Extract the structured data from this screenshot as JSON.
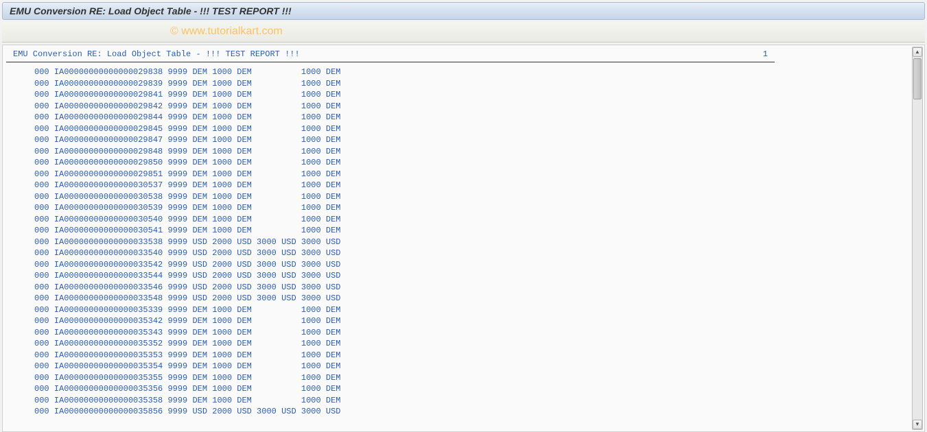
{
  "header": {
    "title": "EMU Conversion RE: Load Object Table - !!! TEST REPORT !!!"
  },
  "watermark": "© www.tutorialkart.com",
  "report": {
    "heading": "EMU Conversion RE: Load Object Table - !!! TEST REPORT !!!",
    "page": "1",
    "rows": [
      {
        "c1": "000",
        "id": "IA00000000000000029838",
        "c2": "9999",
        "c3": "DEM",
        "c4": "1000",
        "c5": "DEM",
        "c6": "",
        "c7": "",
        "c8": "1000",
        "c9": "DEM"
      },
      {
        "c1": "000",
        "id": "IA00000000000000029839",
        "c2": "9999",
        "c3": "DEM",
        "c4": "1000",
        "c5": "DEM",
        "c6": "",
        "c7": "",
        "c8": "1000",
        "c9": "DEM"
      },
      {
        "c1": "000",
        "id": "IA00000000000000029841",
        "c2": "9999",
        "c3": "DEM",
        "c4": "1000",
        "c5": "DEM",
        "c6": "",
        "c7": "",
        "c8": "1000",
        "c9": "DEM"
      },
      {
        "c1": "000",
        "id": "IA00000000000000029842",
        "c2": "9999",
        "c3": "DEM",
        "c4": "1000",
        "c5": "DEM",
        "c6": "",
        "c7": "",
        "c8": "1000",
        "c9": "DEM"
      },
      {
        "c1": "000",
        "id": "IA00000000000000029844",
        "c2": "9999",
        "c3": "DEM",
        "c4": "1000",
        "c5": "DEM",
        "c6": "",
        "c7": "",
        "c8": "1000",
        "c9": "DEM"
      },
      {
        "c1": "000",
        "id": "IA00000000000000029845",
        "c2": "9999",
        "c3": "DEM",
        "c4": "1000",
        "c5": "DEM",
        "c6": "",
        "c7": "",
        "c8": "1000",
        "c9": "DEM"
      },
      {
        "c1": "000",
        "id": "IA00000000000000029847",
        "c2": "9999",
        "c3": "DEM",
        "c4": "1000",
        "c5": "DEM",
        "c6": "",
        "c7": "",
        "c8": "1000",
        "c9": "DEM"
      },
      {
        "c1": "000",
        "id": "IA00000000000000029848",
        "c2": "9999",
        "c3": "DEM",
        "c4": "1000",
        "c5": "DEM",
        "c6": "",
        "c7": "",
        "c8": "1000",
        "c9": "DEM"
      },
      {
        "c1": "000",
        "id": "IA00000000000000029850",
        "c2": "9999",
        "c3": "DEM",
        "c4": "1000",
        "c5": "DEM",
        "c6": "",
        "c7": "",
        "c8": "1000",
        "c9": "DEM"
      },
      {
        "c1": "000",
        "id": "IA00000000000000029851",
        "c2": "9999",
        "c3": "DEM",
        "c4": "1000",
        "c5": "DEM",
        "c6": "",
        "c7": "",
        "c8": "1000",
        "c9": "DEM"
      },
      {
        "c1": "000",
        "id": "IA00000000000000030537",
        "c2": "9999",
        "c3": "DEM",
        "c4": "1000",
        "c5": "DEM",
        "c6": "",
        "c7": "",
        "c8": "1000",
        "c9": "DEM"
      },
      {
        "c1": "000",
        "id": "IA00000000000000030538",
        "c2": "9999",
        "c3": "DEM",
        "c4": "1000",
        "c5": "DEM",
        "c6": "",
        "c7": "",
        "c8": "1000",
        "c9": "DEM"
      },
      {
        "c1": "000",
        "id": "IA00000000000000030539",
        "c2": "9999",
        "c3": "DEM",
        "c4": "1000",
        "c5": "DEM",
        "c6": "",
        "c7": "",
        "c8": "1000",
        "c9": "DEM"
      },
      {
        "c1": "000",
        "id": "IA00000000000000030540",
        "c2": "9999",
        "c3": "DEM",
        "c4": "1000",
        "c5": "DEM",
        "c6": "",
        "c7": "",
        "c8": "1000",
        "c9": "DEM"
      },
      {
        "c1": "000",
        "id": "IA00000000000000030541",
        "c2": "9999",
        "c3": "DEM",
        "c4": "1000",
        "c5": "DEM",
        "c6": "",
        "c7": "",
        "c8": "1000",
        "c9": "DEM"
      },
      {
        "c1": "000",
        "id": "IA00000000000000033538",
        "c2": "9999",
        "c3": "USD",
        "c4": "2000",
        "c5": "USD",
        "c6": "3000",
        "c7": "USD",
        "c8": "3000",
        "c9": "USD"
      },
      {
        "c1": "000",
        "id": "IA00000000000000033540",
        "c2": "9999",
        "c3": "USD",
        "c4": "2000",
        "c5": "USD",
        "c6": "3000",
        "c7": "USD",
        "c8": "3000",
        "c9": "USD"
      },
      {
        "c1": "000",
        "id": "IA00000000000000033542",
        "c2": "9999",
        "c3": "USD",
        "c4": "2000",
        "c5": "USD",
        "c6": "3000",
        "c7": "USD",
        "c8": "3000",
        "c9": "USD"
      },
      {
        "c1": "000",
        "id": "IA00000000000000033544",
        "c2": "9999",
        "c3": "USD",
        "c4": "2000",
        "c5": "USD",
        "c6": "3000",
        "c7": "USD",
        "c8": "3000",
        "c9": "USD"
      },
      {
        "c1": "000",
        "id": "IA00000000000000033546",
        "c2": "9999",
        "c3": "USD",
        "c4": "2000",
        "c5": "USD",
        "c6": "3000",
        "c7": "USD",
        "c8": "3000",
        "c9": "USD"
      },
      {
        "c1": "000",
        "id": "IA00000000000000033548",
        "c2": "9999",
        "c3": "USD",
        "c4": "2000",
        "c5": "USD",
        "c6": "3000",
        "c7": "USD",
        "c8": "3000",
        "c9": "USD"
      },
      {
        "c1": "000",
        "id": "IA00000000000000035339",
        "c2": "9999",
        "c3": "DEM",
        "c4": "1000",
        "c5": "DEM",
        "c6": "",
        "c7": "",
        "c8": "1000",
        "c9": "DEM"
      },
      {
        "c1": "000",
        "id": "IA00000000000000035342",
        "c2": "9999",
        "c3": "DEM",
        "c4": "1000",
        "c5": "DEM",
        "c6": "",
        "c7": "",
        "c8": "1000",
        "c9": "DEM"
      },
      {
        "c1": "000",
        "id": "IA00000000000000035343",
        "c2": "9999",
        "c3": "DEM",
        "c4": "1000",
        "c5": "DEM",
        "c6": "",
        "c7": "",
        "c8": "1000",
        "c9": "DEM"
      },
      {
        "c1": "000",
        "id": "IA00000000000000035352",
        "c2": "9999",
        "c3": "DEM",
        "c4": "1000",
        "c5": "DEM",
        "c6": "",
        "c7": "",
        "c8": "1000",
        "c9": "DEM"
      },
      {
        "c1": "000",
        "id": "IA00000000000000035353",
        "c2": "9999",
        "c3": "DEM",
        "c4": "1000",
        "c5": "DEM",
        "c6": "",
        "c7": "",
        "c8": "1000",
        "c9": "DEM"
      },
      {
        "c1": "000",
        "id": "IA00000000000000035354",
        "c2": "9999",
        "c3": "DEM",
        "c4": "1000",
        "c5": "DEM",
        "c6": "",
        "c7": "",
        "c8": "1000",
        "c9": "DEM"
      },
      {
        "c1": "000",
        "id": "IA00000000000000035355",
        "c2": "9999",
        "c3": "DEM",
        "c4": "1000",
        "c5": "DEM",
        "c6": "",
        "c7": "",
        "c8": "1000",
        "c9": "DEM"
      },
      {
        "c1": "000",
        "id": "IA00000000000000035356",
        "c2": "9999",
        "c3": "DEM",
        "c4": "1000",
        "c5": "DEM",
        "c6": "",
        "c7": "",
        "c8": "1000",
        "c9": "DEM"
      },
      {
        "c1": "000",
        "id": "IA00000000000000035358",
        "c2": "9999",
        "c3": "DEM",
        "c4": "1000",
        "c5": "DEM",
        "c6": "",
        "c7": "",
        "c8": "1000",
        "c9": "DEM"
      },
      {
        "c1": "000",
        "id": "IA00000000000000035856",
        "c2": "9999",
        "c3": "USD",
        "c4": "2000",
        "c5": "USD",
        "c6": "3000",
        "c7": "USD",
        "c8": "3000",
        "c9": "USD"
      }
    ]
  }
}
